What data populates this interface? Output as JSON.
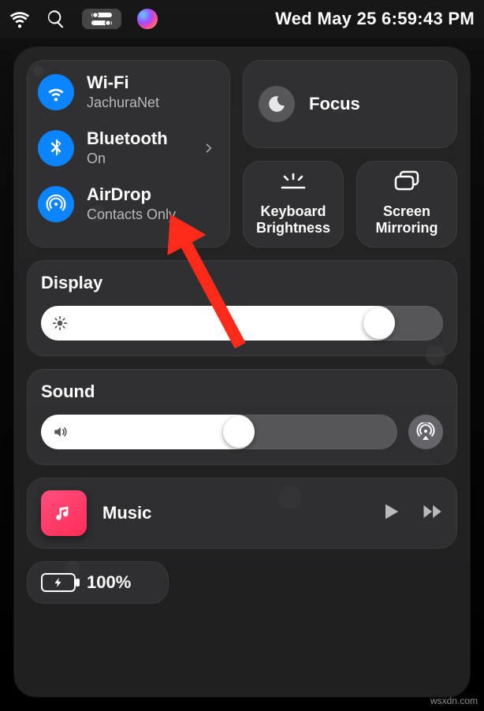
{
  "menubar": {
    "datetime": "Wed May 25  6:59:43 PM"
  },
  "connectivity": {
    "wifi": {
      "title": "Wi-Fi",
      "status": "JachuraNet"
    },
    "bluetooth": {
      "title": "Bluetooth",
      "status": "On"
    },
    "airdrop": {
      "title": "AirDrop",
      "status": "Contacts Only"
    }
  },
  "focus": {
    "title": "Focus"
  },
  "tiles": {
    "keyboard_brightness": "Keyboard Brightness",
    "screen_mirroring": "Screen Mirroring"
  },
  "display": {
    "heading": "Display",
    "value_pct": 88
  },
  "sound": {
    "heading": "Sound",
    "value_pct": 60
  },
  "music": {
    "title": "Music"
  },
  "battery": {
    "text": "100%"
  },
  "watermark": "wsxdn.com"
}
